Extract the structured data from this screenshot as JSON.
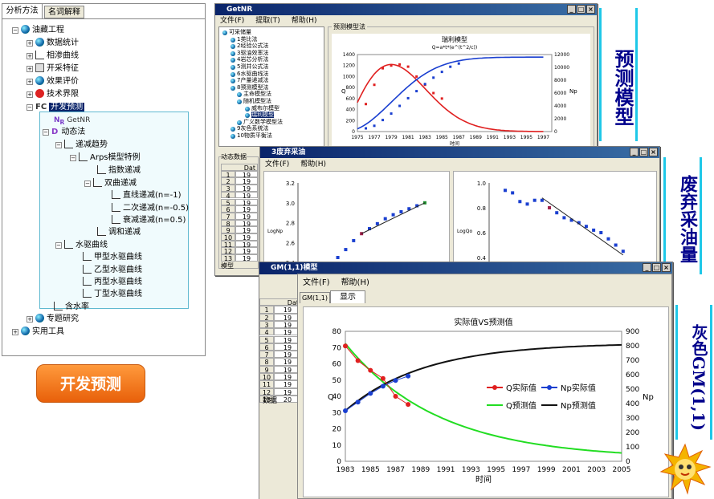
{
  "left_panel": {
    "tabs": [
      "分析方法",
      "名词解释"
    ],
    "tree": [
      {
        "label": "油藏工程"
      },
      {
        "label": "数据统计"
      },
      {
        "label": "相渗曲线"
      },
      {
        "label": "开采特征"
      },
      {
        "label": "效果评价"
      },
      {
        "label": "技术界限"
      },
      {
        "label": "开发预测"
      },
      {
        "label": "GetNR"
      },
      {
        "label": "动态法"
      },
      {
        "label": "递减趋势"
      },
      {
        "label": "Arps模型特例"
      },
      {
        "label": "指数递减"
      },
      {
        "label": "双曲递减"
      },
      {
        "label": "直线递减(n=-1)"
      },
      {
        "label": "二次递减(n=-0.5)"
      },
      {
        "label": "衰减递减(n=0.5)"
      },
      {
        "label": "调和递减"
      },
      {
        "label": "水驱曲线"
      },
      {
        "label": "甲型水驱曲线"
      },
      {
        "label": "乙型水驱曲线"
      },
      {
        "label": "丙型水驱曲线"
      },
      {
        "label": "丁型水驱曲线"
      },
      {
        "label": "含水率"
      },
      {
        "label": "专题研究"
      },
      {
        "label": "实用工具"
      }
    ],
    "big_button": "开发预测"
  },
  "side_labels": {
    "predict": "预测模型",
    "abandon": "废弃采油量",
    "gm": "灰色GM(1,1)"
  },
  "win1": {
    "title": "GetNR",
    "menu": [
      "文件(F)",
      "提取(T)",
      "帮助(H)"
    ],
    "tree": [
      "可采储量",
      "1类比法",
      "2经验公式法",
      "3驱油效率法",
      "4岩芯分析法",
      "5测井公式法",
      "6水驱曲线法",
      "7产量递减法",
      "8预测模型法",
      "主命模型法",
      "随机模型法",
      "威布尔模型",
      "瑞利模型",
      "广义数学模型法",
      "9灰色系统法",
      "10物质平衡法"
    ],
    "group": "预测模型法",
    "grid_label": "动态数据",
    "grid_header": "Dat",
    "rows": [
      "1",
      "2",
      "3",
      "4",
      "5",
      "6",
      "7",
      "8",
      "9",
      "10",
      "11",
      "12",
      "13"
    ],
    "row_vals": [
      "19",
      "19",
      "19",
      "19",
      "19",
      "19",
      "19",
      "19",
      "19",
      "19",
      "19",
      "19",
      "19"
    ],
    "tab": "模型"
  },
  "win2": {
    "title": "3废弃采油",
    "menu": [
      "文件(F)",
      "帮助(H)"
    ],
    "left_ylabel": "LogNp",
    "right_ylabel": "LogQo"
  },
  "win3": {
    "title": "GM(1,1)模型",
    "menu": [
      "文件(F)",
      "帮助(H)"
    ],
    "tabs": [
      "GM(1,1)",
      "显示"
    ],
    "grid_header": "Dat",
    "rows": [
      "1",
      "2",
      "3",
      "4",
      "5",
      "6",
      "7",
      "8",
      "9",
      "10",
      "11",
      "12",
      "13"
    ],
    "row_vals": [
      "19",
      "19",
      "19",
      "19",
      "19",
      "19",
      "19",
      "19",
      "19",
      "19",
      "19",
      "19",
      "20"
    ],
    "tab": "数据"
  },
  "chart_data": [
    {
      "type": "line",
      "title": "瑞利模型",
      "subtitle": "Q=a*t*(e^(t^2/c))",
      "ylabel": "Q",
      "y2label": "Np",
      "xlabel": "时间",
      "x_ticks": [
        1975,
        1977,
        1979,
        1981,
        1983,
        1985,
        1987,
        1989,
        1991,
        1993,
        1995,
        1997
      ],
      "ylim": [
        0,
        1400
      ],
      "y2lim": [
        0,
        12000
      ],
      "y_ticks": [
        0,
        200,
        400,
        600,
        800,
        1000,
        1200,
        1400
      ],
      "y2_ticks": [
        0,
        2000,
        4000,
        6000,
        8000,
        10000,
        12000
      ],
      "series": [
        {
          "color": "#e02020",
          "x": [
            1976,
            1977,
            1978,
            1979,
            1980,
            1981,
            1982,
            1983,
            1984,
            1985
          ],
          "values": [
            500,
            850,
            1150,
            1200,
            1220,
            1180,
            1000,
            850,
            700,
            600
          ]
        },
        {
          "color": "#1a3fd0",
          "x": [
            1976,
            1977,
            1978,
            1979,
            1980,
            1981,
            1982,
            1983,
            1984,
            1985,
            1986,
            1987
          ],
          "values": [
            500,
            900,
            1800,
            2800,
            4000,
            5200,
            6300,
            7400,
            8400,
            9300,
            10100,
            10600
          ]
        }
      ]
    },
    {
      "type": "scatter",
      "ylabel": "LogNp",
      "ylim": [
        2.2,
        3.2
      ],
      "y_ticks": [
        2.2,
        2.4,
        2.6,
        2.8,
        3.0,
        3.2
      ],
      "values": [
        2.22,
        2.27,
        2.36,
        2.45,
        2.53,
        2.62,
        2.69,
        2.74,
        2.79,
        2.84,
        2.88,
        2.91,
        2.94,
        2.97,
        3.0
      ]
    },
    {
      "type": "scatter",
      "ylabel": "LogQo",
      "ylim": [
        0.2,
        1.0
      ],
      "y_ticks": [
        0.2,
        0.4,
        0.6,
        0.8,
        1.0
      ],
      "values": [
        0.94,
        0.92,
        0.85,
        0.83,
        0.86,
        0.86,
        0.8,
        0.76,
        0.72,
        0.7,
        0.68,
        0.65,
        0.62,
        0.6,
        0.55,
        0.5,
        0.45,
        0.29
      ]
    },
    {
      "type": "line",
      "title": "实际值VS预测值",
      "xlabel": "时间",
      "ylabel": "Q",
      "y2label": "Np",
      "ylim": [
        0,
        80
      ],
      "y2lim": [
        0,
        900
      ],
      "y_ticks": [
        0,
        10,
        20,
        30,
        40,
        50,
        60,
        70,
        80
      ],
      "y2_ticks": [
        0,
        100,
        200,
        300,
        400,
        500,
        600,
        700,
        800,
        900
      ],
      "x_ticks": [
        1983,
        1985,
        1987,
        1989,
        1991,
        1993,
        1995,
        1997,
        1999,
        2001,
        2003,
        2005
      ],
      "legend": [
        "Q实际值",
        "Np实际值",
        "Q预测值",
        "Np预测值"
      ],
      "series": [
        {
          "name": "Q实际值",
          "color": "#e02020",
          "x": [
            1983,
            1984,
            1985,
            1986,
            1987,
            1988
          ],
          "values": [
            71,
            62,
            56,
            51,
            40,
            35
          ]
        },
        {
          "name": "Np实际值",
          "color": "#1a3fd0",
          "x": [
            1983,
            1984,
            1985,
            1986,
            1987,
            1988
          ],
          "values": [
            350,
            410,
            470,
            520,
            560,
            590
          ]
        },
        {
          "name": "Q预测值",
          "color": "#22dd22",
          "x": [
            1983,
            1985,
            1987,
            1989,
            1991,
            1993,
            1995,
            1997,
            1999,
            2001,
            2003,
            2005
          ],
          "values": [
            71,
            56,
            44,
            34,
            27,
            21,
            16,
            12,
            9,
            7,
            5,
            3
          ]
        },
        {
          "name": "Np预测值",
          "color": "#111111",
          "x": [
            1983,
            1985,
            1987,
            1989,
            1991,
            1993,
            1995,
            1997,
            1999,
            2001,
            2003,
            2005
          ],
          "values": [
            350,
            470,
            560,
            630,
            680,
            720,
            750,
            770,
            785,
            795,
            805,
            810
          ]
        }
      ]
    }
  ]
}
